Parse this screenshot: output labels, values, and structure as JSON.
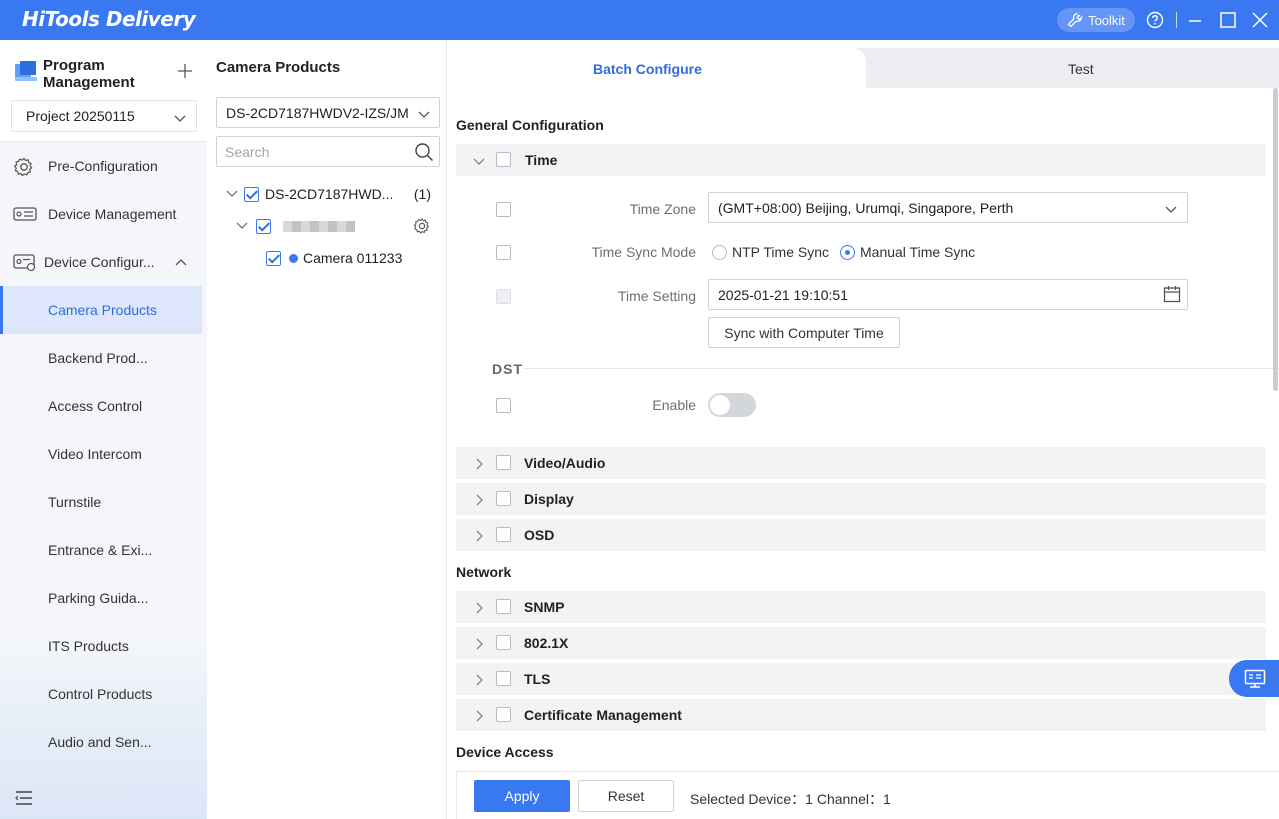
{
  "titlebar": {
    "app_title": "HiTools Delivery",
    "toolkit_label": "Toolkit"
  },
  "sidebar": {
    "program_title": "Program Management",
    "project_select": "Project 20250115",
    "items": [
      {
        "label": "Pre-Configuration",
        "icon": "gear-icon"
      },
      {
        "label": "Device Management",
        "icon": "device-icon"
      },
      {
        "label": "Device Configur...",
        "icon": "device-config-icon"
      },
      {
        "label": "Camera Products"
      },
      {
        "label": "Backend Prod..."
      },
      {
        "label": "Access Control"
      },
      {
        "label": "Video Intercom"
      },
      {
        "label": "Turnstile"
      },
      {
        "label": "Entrance & Exi..."
      },
      {
        "label": "Parking Guida..."
      },
      {
        "label": "ITS Products"
      },
      {
        "label": "Control Products"
      },
      {
        "label": "Audio and Sen..."
      }
    ]
  },
  "tree": {
    "title": "Camera Products",
    "model_select": "DS-2CD7187HWDV2-IZS/JM",
    "search_placeholder": "Search",
    "root_label": "DS-2CD7187HWD...",
    "root_count": "(1)",
    "camera_label": "Camera 011233"
  },
  "tabs": {
    "batch": "Batch Configure",
    "test": "Test"
  },
  "config": {
    "general_heading": "General Configuration",
    "time_group": "Time",
    "time_zone_label": "Time Zone",
    "time_zone_value": "(GMT+08:00) Beijing, Urumqi, Singapore, Perth",
    "sync_mode_label": "Time Sync Mode",
    "ntp_option": "NTP Time Sync",
    "manual_option": "Manual Time Sync",
    "time_setting_label": "Time Setting",
    "time_setting_value": "2025-01-21 19:10:51",
    "sync_button": "Sync with Computer Time",
    "dst_label": "DST",
    "enable_label": "Enable",
    "general_groups": [
      "Video/Audio",
      "Display",
      "OSD"
    ],
    "network_heading": "Network",
    "network_groups": [
      "SNMP",
      "802.1X",
      "TLS",
      "Certificate Management"
    ],
    "device_access_heading": "Device Access"
  },
  "footer": {
    "apply": "Apply",
    "reset": "Reset",
    "selected_info": "Selected Device：1 Channel：1"
  },
  "colors": {
    "accent": "#3a78f2",
    "active_nav_bg": "#dde6fb",
    "group_bg": "#f2f3f5"
  }
}
